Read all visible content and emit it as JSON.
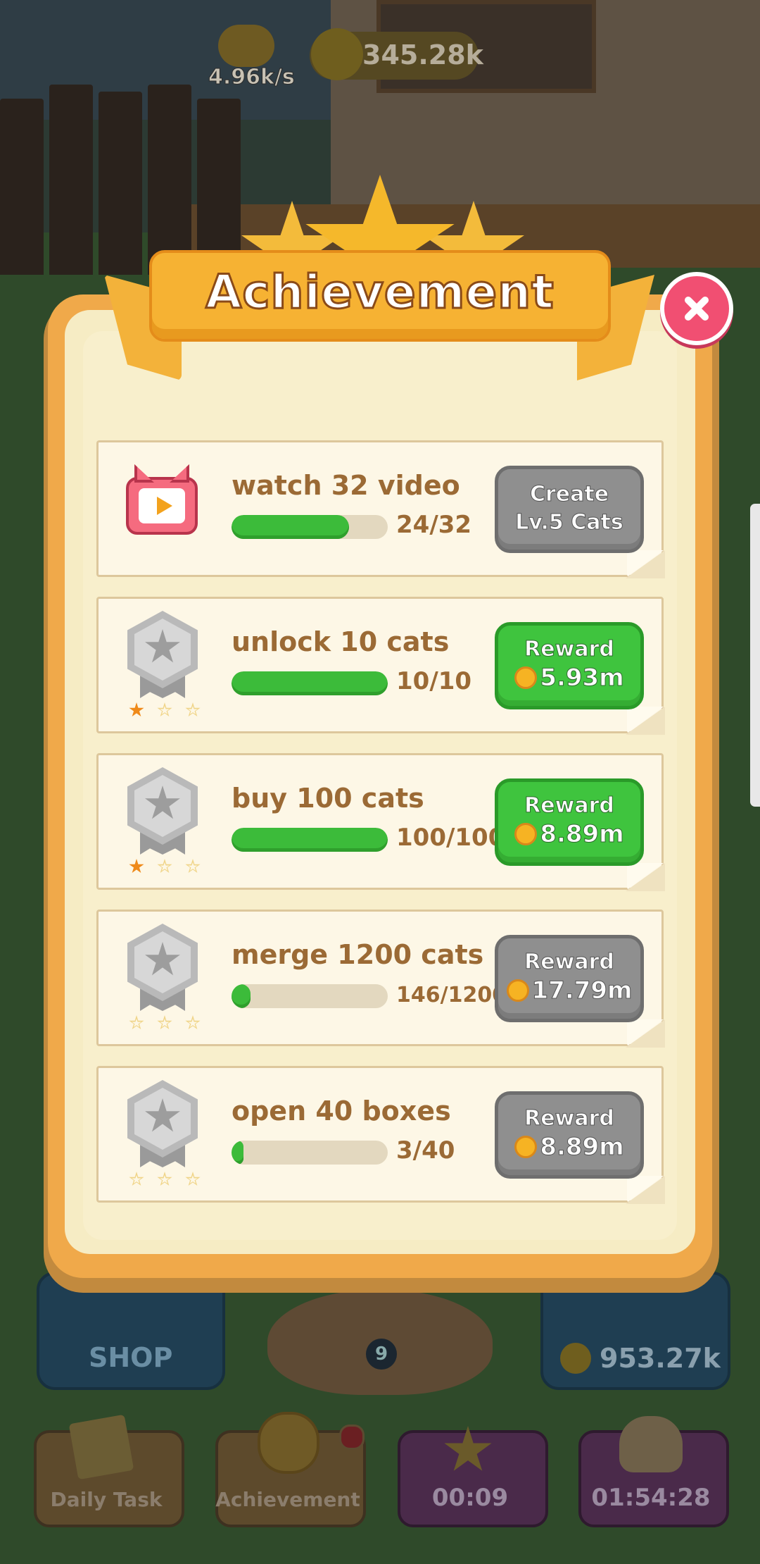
{
  "hud": {
    "coin_rate": "4.96k/s",
    "money": "345.28k"
  },
  "bottom": {
    "shop_label": "SHOP",
    "cat_level": "9",
    "coin_box_value": "953.27k",
    "tabs": [
      {
        "label": "Daily Task"
      },
      {
        "label": "Achievement",
        "has_badge": true
      },
      {
        "label": "00:09"
      },
      {
        "label": "01:54:28"
      }
    ]
  },
  "modal": {
    "title": "Achievement",
    "close_icon": "close-icon",
    "rows": [
      {
        "icon": "video-tv-icon",
        "title": "watch 32 video",
        "progress_text": "24/32",
        "progress": 0.75,
        "button_type": "gray",
        "button_line1": "Create",
        "button_line2": "Lv.5 Cats",
        "stars_earned": 0
      },
      {
        "icon": "silver-medal-icon",
        "title": "unlock 10 cats",
        "progress_text": "10/10",
        "progress": 1.0,
        "button_type": "green",
        "button_label": "Reward",
        "reward_amount": "5.93m",
        "stars_earned": 1
      },
      {
        "icon": "silver-medal-icon",
        "title": "buy 100 cats",
        "progress_text": "100/100",
        "progress": 1.0,
        "button_type": "green",
        "button_label": "Reward",
        "reward_amount": "8.89m",
        "stars_earned": 1
      },
      {
        "icon": "silver-medal-icon",
        "title": "merge 1200 cats",
        "progress_text": "146/1200",
        "progress": 0.12,
        "button_type": "gray",
        "button_label": "Reward",
        "reward_amount": "17.79m",
        "stars_earned": 0
      },
      {
        "icon": "silver-medal-icon",
        "title": "open 40 boxes",
        "progress_text": "3/40",
        "progress": 0.075,
        "button_type": "gray",
        "button_label": "Reward",
        "reward_amount": "8.89m",
        "stars_earned": 0
      }
    ]
  },
  "colors": {
    "progress_green": "#3cbb3a",
    "reward_green": "#3fc43e",
    "disabled_gray": "#8f8f8f",
    "ribbon_orange": "#f6b233",
    "close_pink": "#f14f72",
    "text_brown": "#9b6a35"
  }
}
